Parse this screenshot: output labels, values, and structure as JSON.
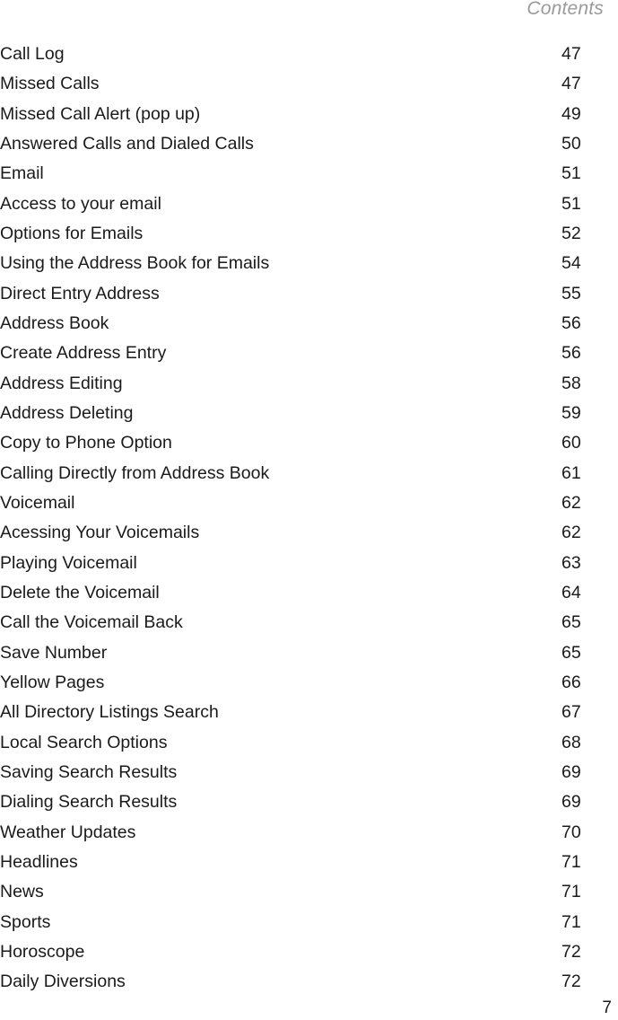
{
  "header": {
    "title": "Contents"
  },
  "toc": [
    {
      "title": "Call Log",
      "page": "47"
    },
    {
      "title": "Missed Calls",
      "page": "47"
    },
    {
      "title": "Missed Call Alert (pop up)",
      "page": "49"
    },
    {
      "title": "Answered Calls and Dialed Calls",
      "page": "50"
    },
    {
      "title": "Email",
      "page": "51"
    },
    {
      "title": "Access to your email",
      "page": "51"
    },
    {
      "title": "Options for Emails",
      "page": "52"
    },
    {
      "title": "Using the Address Book for Emails",
      "page": "54"
    },
    {
      "title": "Direct Entry Address",
      "page": "55"
    },
    {
      "title": "Address Book",
      "page": "56"
    },
    {
      "title": "Create Address Entry",
      "page": "56"
    },
    {
      "title": "Address Editing",
      "page": "58"
    },
    {
      "title": "Address Deleting",
      "page": "59"
    },
    {
      "title": "Copy to Phone Option",
      "page": "60"
    },
    {
      "title": "Calling Directly from Address Book",
      "page": "61"
    },
    {
      "title": "Voicemail",
      "page": "62"
    },
    {
      "title": "Acessing Your Voicemails",
      "page": "62"
    },
    {
      "title": "Playing Voicemail",
      "page": "63"
    },
    {
      "title": "Delete the Voicemail",
      "page": "64"
    },
    {
      "title": "Call the Voicemail Back",
      "page": "65"
    },
    {
      "title": "Save Number",
      "page": "65"
    },
    {
      "title": "Yellow Pages",
      "page": "66"
    },
    {
      "title": "All Directory Listings Search",
      "page": "67"
    },
    {
      "title": "Local Search Options",
      "page": "68"
    },
    {
      "title": "Saving Search Results",
      "page": "69"
    },
    {
      "title": "Dialing Search Results",
      "page": "69"
    },
    {
      "title": "Weather Updates",
      "page": "70"
    },
    {
      "title": "Headlines",
      "page": "71"
    },
    {
      "title": "News",
      "page": "71"
    },
    {
      "title": "Sports",
      "page": "71"
    },
    {
      "title": "Horoscope",
      "page": "72"
    },
    {
      "title": "Daily Diversions",
      "page": "72"
    }
  ],
  "footer": {
    "page_number": "7"
  }
}
